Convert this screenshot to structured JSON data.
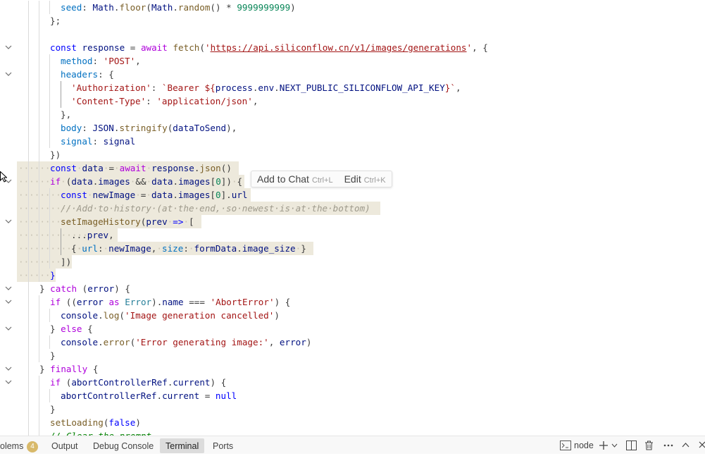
{
  "editor": {
    "tooltip": {
      "add_to_chat": "Add to Chat",
      "add_to_chat_key": "Ctrl+L",
      "edit": "Edit",
      "edit_key": "Ctrl+K"
    }
  },
  "panel": {
    "problems_label": "olems",
    "problems_count": "4",
    "tabs": [
      "Output",
      "Debug Console",
      "Terminal",
      "Ports"
    ],
    "active_tab": "Terminal",
    "terminal_name": "node",
    "icons": [
      "terminal-icon",
      "plus-icon",
      "chevron-down-icon",
      "split-icon",
      "trash-icon",
      "ellipsis-icon",
      "chevron-up-icon",
      "close-icon"
    ]
  },
  "colors": {
    "selection": "#ede9dc",
    "keyword": "#0000ff",
    "control": "#af00db",
    "string": "#a31515",
    "number": "#098658",
    "badge": "#d8b96a"
  }
}
